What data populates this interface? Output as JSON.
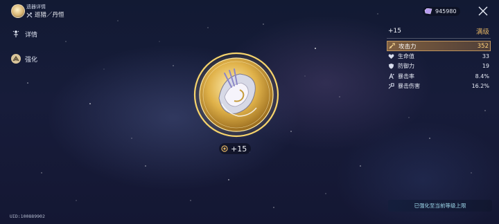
{
  "header": {
    "title": "遗器详情",
    "subtitle": "巡猎／丹恒",
    "path_icon": "arrows-path-icon",
    "avatar_icon": "character-avatar-icon"
  },
  "nav": {
    "items": [
      {
        "label": "详情",
        "icon": "sparkle-figure-icon",
        "selected": false
      },
      {
        "label": "强化",
        "icon": "upgrade-emblem-icon",
        "selected": true
      }
    ]
  },
  "topbar": {
    "currency_value": "945980",
    "currency_icon": "purple-gem-icon",
    "close_icon": "close-icon"
  },
  "relic": {
    "level": "+15",
    "level_icon": "ring-level-icon"
  },
  "stats": {
    "level": "+15",
    "status": "满级",
    "main": {
      "name": "攻击力",
      "value": "352",
      "icon": "sword-icon"
    },
    "sub": [
      {
        "name": "生命值",
        "value": "33",
        "icon": "heart-icon"
      },
      {
        "name": "防御力",
        "value": "19",
        "icon": "shield-icon"
      },
      {
        "name": "暴击率",
        "value": "8.4%",
        "icon": "crit-rate-icon"
      },
      {
        "name": "暴击伤害",
        "value": "16.2%",
        "icon": "crit-damage-icon"
      }
    ]
  },
  "notice": "已强化至当前等级上限",
  "uid": "UID:100889902",
  "colors": {
    "accent_gold": "#e2b262",
    "main_stat_value": "#ffd27a",
    "notice_text": "#9ed8ea",
    "background": "#151b36"
  }
}
